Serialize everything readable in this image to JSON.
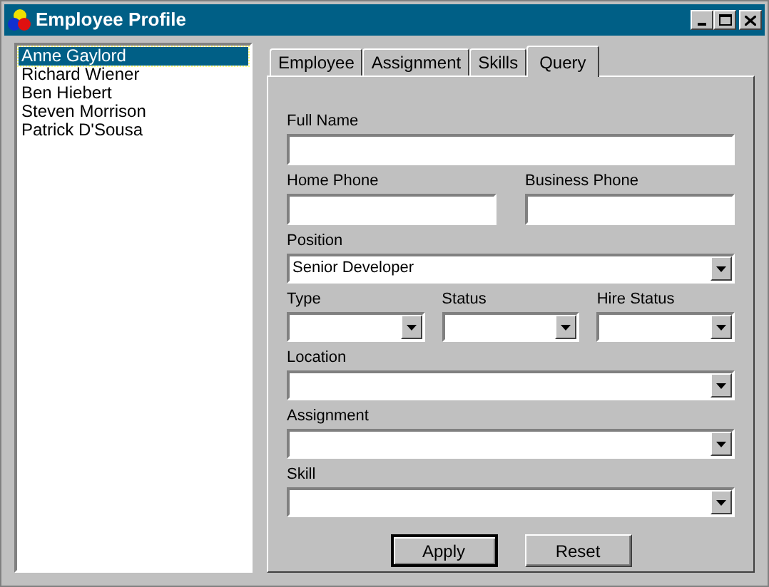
{
  "window": {
    "title": "Employee Profile"
  },
  "employees": [
    {
      "name": "Anne Gaylord",
      "selected": true
    },
    {
      "name": "Richard Wiener",
      "selected": false
    },
    {
      "name": "Ben Hiebert",
      "selected": false
    },
    {
      "name": "Steven Morrison",
      "selected": false
    },
    {
      "name": "Patrick D'Sousa",
      "selected": false
    }
  ],
  "tabs": [
    {
      "label": "Employee",
      "selected": false
    },
    {
      "label": "Assignment",
      "selected": false
    },
    {
      "label": "Skills",
      "selected": false
    },
    {
      "label": "Query",
      "selected": true
    }
  ],
  "form_rows": [
    [
      {
        "label": "Full Name",
        "kind": "text"
      }
    ],
    [
      {
        "label": "Home Phone",
        "kind": "text"
      },
      {
        "label": "Business Phone",
        "kind": "text"
      }
    ],
    [
      {
        "label": "Position",
        "kind": "combo",
        "value": "Senior Developer"
      }
    ],
    [
      {
        "label": "Type",
        "kind": "combo"
      },
      {
        "label": "Status",
        "kind": "combo"
      },
      {
        "label": "Hire Status",
        "kind": "combo"
      }
    ],
    [
      {
        "label": "Location",
        "kind": "combo"
      }
    ],
    [
      {
        "label": "Assignment",
        "kind": "combo"
      }
    ],
    [
      {
        "label": "Skill",
        "kind": "combo"
      }
    ]
  ],
  "buttons": [
    {
      "label": "Apply",
      "default": true
    },
    {
      "label": "Reset",
      "default": false
    }
  ]
}
